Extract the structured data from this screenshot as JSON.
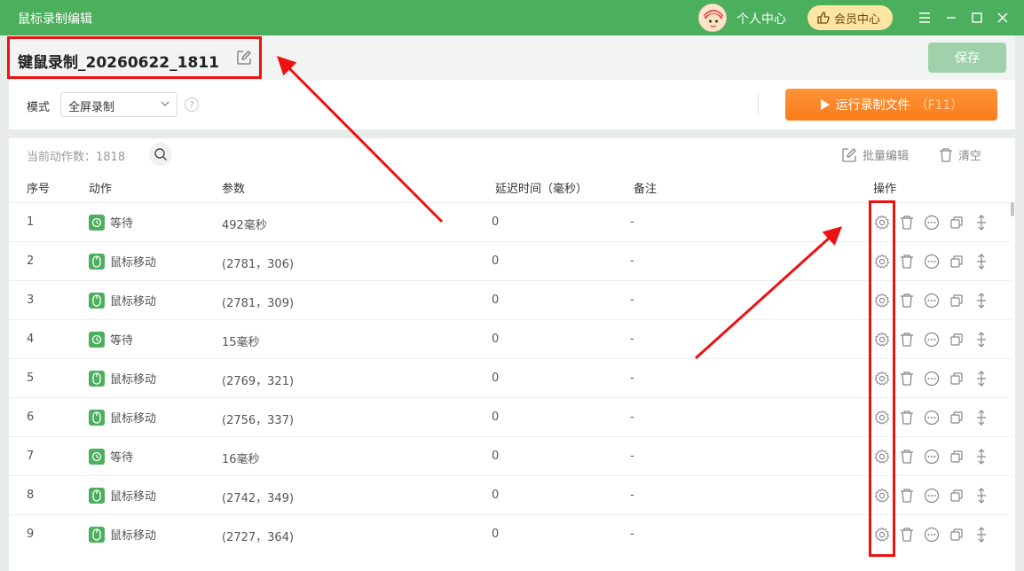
{
  "window": {
    "title": "鼠标录制编辑",
    "user_center": "个人中心",
    "vip_label": "会员中心",
    "accent_color": "#4caf5d"
  },
  "record": {
    "name": "键鼠录制_20260622_1811",
    "save_label": "保存"
  },
  "mode": {
    "label": "模式",
    "selected": "全屏录制",
    "help": "?"
  },
  "run": {
    "label": "运行录制文件",
    "hotkey": "（F11）"
  },
  "toolbar": {
    "count_label": "当前动作数：1818",
    "batch_edit": "批量编辑",
    "clear": "清空"
  },
  "table": {
    "headers": [
      "序号",
      "动作",
      "参数",
      "延迟时间（毫秒）",
      "备注",
      "操作"
    ],
    "rows": [
      {
        "no": "1",
        "action": "等待",
        "icon": "clock-icon",
        "param": "492毫秒",
        "delay": "0",
        "note": "-"
      },
      {
        "no": "2",
        "action": "鼠标移动",
        "icon": "mouse-icon",
        "param": "(2781，306)",
        "delay": "0",
        "note": "-"
      },
      {
        "no": "3",
        "action": "鼠标移动",
        "icon": "mouse-icon",
        "param": "(2781，309)",
        "delay": "0",
        "note": "-"
      },
      {
        "no": "4",
        "action": "等待",
        "icon": "clock-icon",
        "param": "15毫秒",
        "delay": "0",
        "note": "-"
      },
      {
        "no": "5",
        "action": "鼠标移动",
        "icon": "mouse-icon",
        "param": "(2769，321)",
        "delay": "0",
        "note": "-"
      },
      {
        "no": "6",
        "action": "鼠标移动",
        "icon": "mouse-icon",
        "param": "(2756，337)",
        "delay": "0",
        "note": "-"
      },
      {
        "no": "7",
        "action": "等待",
        "icon": "clock-icon",
        "param": "16毫秒",
        "delay": "0",
        "note": "-"
      },
      {
        "no": "8",
        "action": "鼠标移动",
        "icon": "mouse-icon",
        "param": "(2742，349)",
        "delay": "0",
        "note": "-"
      },
      {
        "no": "9",
        "action": "鼠标移动",
        "icon": "mouse-icon",
        "param": "(2727，364)",
        "delay": "0",
        "note": "-"
      }
    ],
    "operations": [
      "settings-icon",
      "delete-icon",
      "more-icon",
      "copy-icon",
      "move-icon"
    ]
  },
  "annotation": {
    "color": "#ee1111"
  }
}
